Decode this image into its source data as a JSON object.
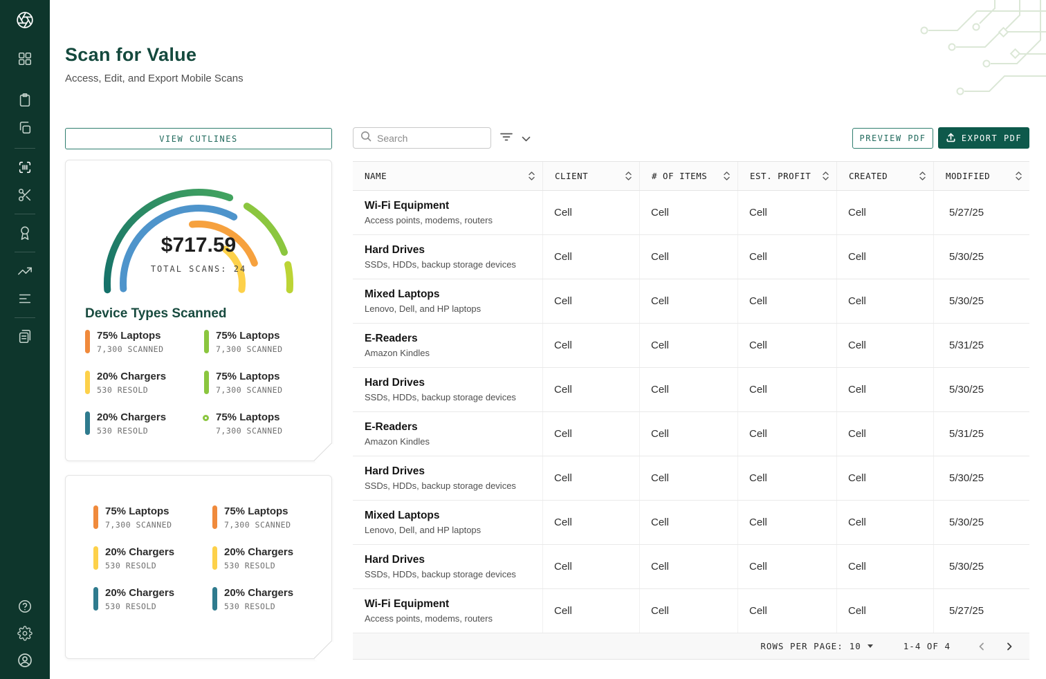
{
  "page": {
    "title": "Scan for Value",
    "subtitle": "Access, Edit, and Export Mobile Scans"
  },
  "sidebar": {
    "icons": [
      "aperture-logo",
      "dashboard",
      "clipboard",
      "copy",
      "barcode-scan",
      "scissors",
      "medal",
      "trending-up",
      "list",
      "documents",
      "help",
      "settings",
      "account"
    ],
    "active": "barcode-scan"
  },
  "toolbar": {
    "view_cutlines": "VIEW CUTLINES",
    "preview_pdf": "PREVIEW PDF",
    "export_pdf": "EXPORT PDF",
    "search_placeholder": "Search"
  },
  "gauge": {
    "value": "$717.59",
    "scans_label": "TOTAL SCANS: 24"
  },
  "device_types": {
    "heading": "Device Types Scanned",
    "items": [
      {
        "label": "75% Laptops",
        "sub": "7,300 SCANNED",
        "color": "#f08a3c",
        "marker": "bar"
      },
      {
        "label": "75% Laptops",
        "sub": "7,300 SCANNED",
        "color": "#8bc63f",
        "marker": "bar"
      },
      {
        "label": "20% Chargers",
        "sub": "530 RESOLD",
        "color": "#fdd14a",
        "marker": "bar"
      },
      {
        "label": "75% Laptops",
        "sub": "7,300 SCANNED",
        "color": "#8bc63f",
        "marker": "bar"
      },
      {
        "label": "20% Chargers",
        "sub": "530 RESOLD",
        "color": "#2f7b8e",
        "marker": "bar"
      },
      {
        "label": "75% Laptops",
        "sub": "7,300 SCANNED",
        "color": "#8bc63f",
        "marker": "dot"
      }
    ]
  },
  "summary_panel": {
    "items": [
      {
        "label": "75% Laptops",
        "sub": "7,300 SCANNED",
        "color": "#f08a3c"
      },
      {
        "label": "75% Laptops",
        "sub": "7,300 SCANNED",
        "color": "#f08a3c"
      },
      {
        "label": "20% Chargers",
        "sub": "530 RESOLD",
        "color": "#fdd14a"
      },
      {
        "label": "20% Chargers",
        "sub": "530 RESOLD",
        "color": "#fdd14a"
      },
      {
        "label": "20% Chargers",
        "sub": "530 RESOLD",
        "color": "#2f7b8e"
      },
      {
        "label": "20% Chargers",
        "sub": "530 RESOLD",
        "color": "#2f7b8e"
      }
    ]
  },
  "table": {
    "columns": [
      "NAME",
      "CLIENT",
      "# OF ITEMS",
      "EST. PROFIT",
      "CREATED",
      "MODIFIED"
    ],
    "rows": [
      {
        "name": "Wi-Fi Equipment",
        "desc": "Access points, modems, routers",
        "client": "Cell",
        "items": "Cell",
        "profit": "Cell",
        "created": "Cell",
        "modified": "5/27/25"
      },
      {
        "name": "Hard Drives",
        "desc": "SSDs, HDDs, backup storage devices",
        "client": "Cell",
        "items": "Cell",
        "profit": "Cell",
        "created": "Cell",
        "modified": "5/30/25"
      },
      {
        "name": "Mixed Laptops",
        "desc": "Lenovo, Dell, and HP laptops",
        "client": "Cell",
        "items": "Cell",
        "profit": "Cell",
        "created": "Cell",
        "modified": "5/30/25"
      },
      {
        "name": "E-Readers",
        "desc": "Amazon Kindles",
        "client": "Cell",
        "items": "Cell",
        "profit": "Cell",
        "created": "Cell",
        "modified": "5/31/25"
      },
      {
        "name": "Hard Drives",
        "desc": "SSDs, HDDs, backup storage devices",
        "client": "Cell",
        "items": "Cell",
        "profit": "Cell",
        "created": "Cell",
        "modified": "5/30/25"
      },
      {
        "name": "E-Readers",
        "desc": "Amazon Kindles",
        "client": "Cell",
        "items": "Cell",
        "profit": "Cell",
        "created": "Cell",
        "modified": "5/31/25"
      },
      {
        "name": "Hard Drives",
        "desc": "SSDs, HDDs, backup storage devices",
        "client": "Cell",
        "items": "Cell",
        "profit": "Cell",
        "created": "Cell",
        "modified": "5/30/25"
      },
      {
        "name": "Mixed Laptops",
        "desc": "Lenovo, Dell, and HP laptops",
        "client": "Cell",
        "items": "Cell",
        "profit": "Cell",
        "created": "Cell",
        "modified": "5/30/25"
      },
      {
        "name": "Hard Drives",
        "desc": "SSDs, HDDs, backup storage devices",
        "client": "Cell",
        "items": "Cell",
        "profit": "Cell",
        "created": "Cell",
        "modified": "5/30/25"
      },
      {
        "name": "Wi-Fi Equipment",
        "desc": "Access points, modems, routers",
        "client": "Cell",
        "items": "Cell",
        "profit": "Cell",
        "created": "Cell",
        "modified": "5/27/25"
      }
    ],
    "footer": {
      "rows_per_page_label": "ROWS PER PAGE:",
      "rows_per_page_value": "10",
      "range": "1-4 OF 4"
    }
  },
  "colors": {
    "sidebar": "#0e362c",
    "accent": "#2e7d6e",
    "export_button": "#0e594b",
    "heading": "#14493d",
    "gauge_teal": "#177568",
    "gauge_green": "#8bc63f",
    "gauge_lime": "#bcd435",
    "gauge_blue": "#4e94cb",
    "gauge_orange": "#f6a13e",
    "gauge_yellow": "#fdd14a",
    "legend_teal": "#2f7b8e",
    "circuit": "#dbe7d6"
  }
}
